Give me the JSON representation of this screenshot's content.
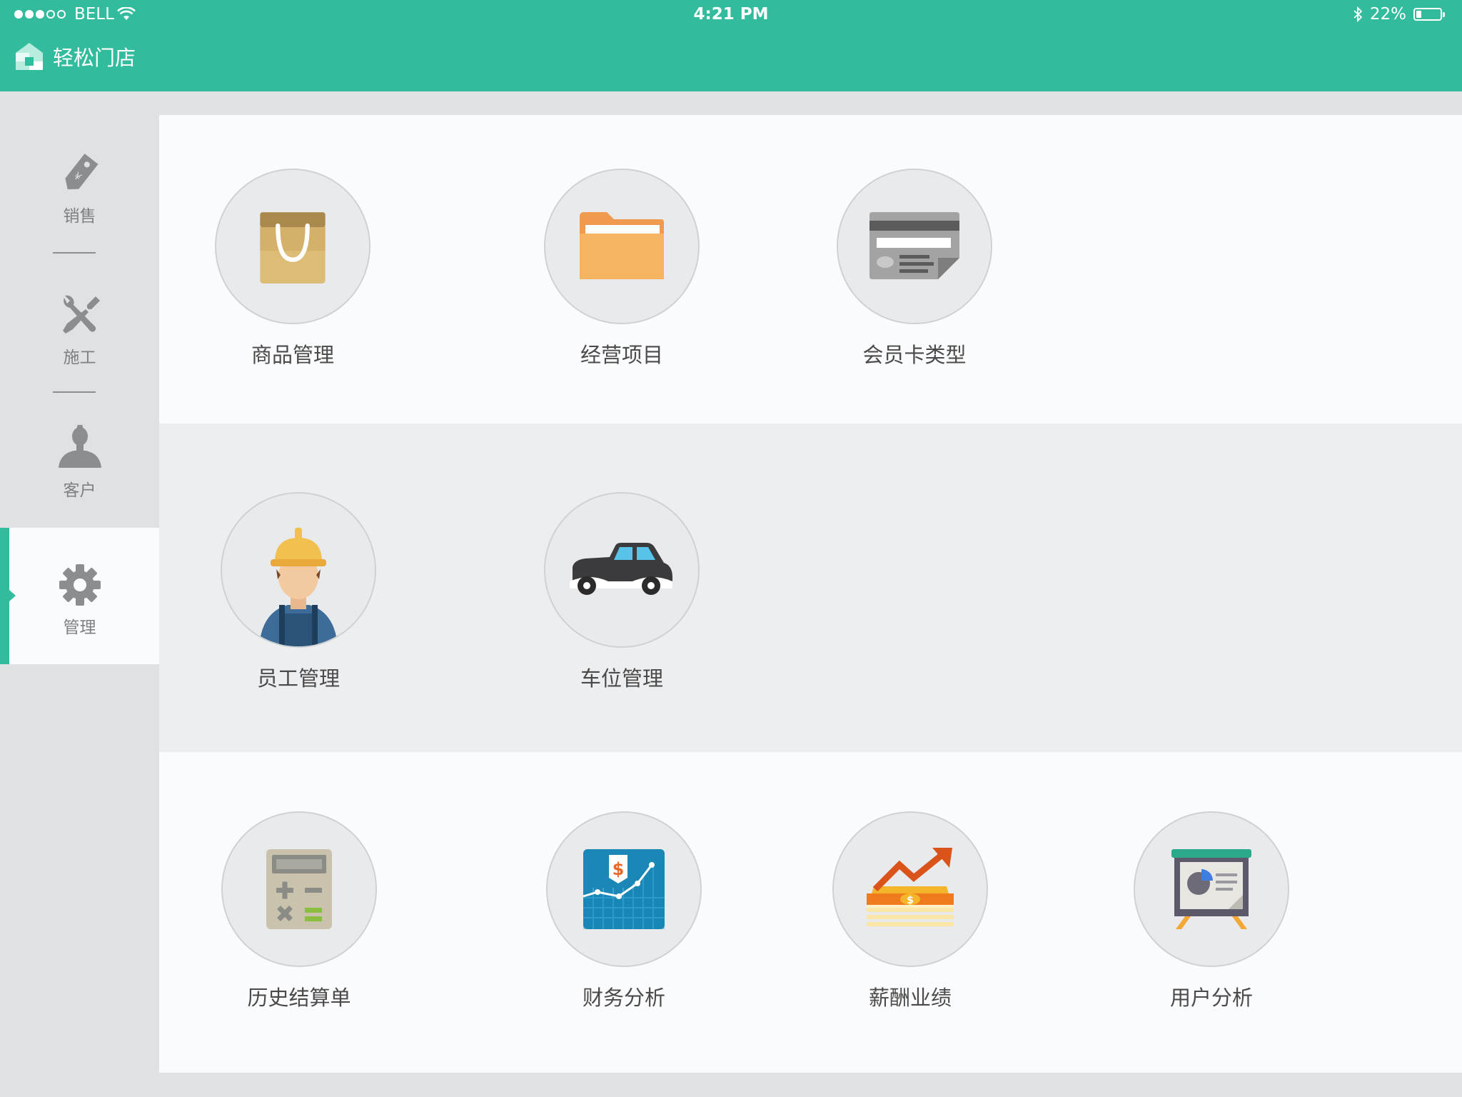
{
  "status_bar": {
    "signal_filled": 3,
    "signal_total": 5,
    "carrier": "BELL",
    "time": "4:21 PM",
    "battery": "22%",
    "battery_level": 0.22,
    "icons": [
      "wifi-icon",
      "bluetooth-icon",
      "battery-icon"
    ]
  },
  "header": {
    "title": "轻松门店",
    "logo_icon": "store-logo-icon"
  },
  "sidebar": {
    "items": [
      {
        "label": "销售",
        "icon": "price-tag-icon",
        "active": false
      },
      {
        "label": "施工",
        "icon": "tools-icon",
        "active": false
      },
      {
        "label": "客户",
        "icon": "person-icon",
        "active": false
      },
      {
        "label": "管理",
        "icon": "gear-icon",
        "active": true
      }
    ]
  },
  "sections": [
    {
      "items": [
        {
          "label": "商品管理",
          "icon": "shopping-bag-icon"
        },
        {
          "label": "经营项目",
          "icon": "folder-icon"
        },
        {
          "label": "会员卡类型",
          "icon": "member-card-icon"
        }
      ]
    },
    {
      "items": [
        {
          "label": "员工管理",
          "icon": "worker-icon"
        },
        {
          "label": "车位管理",
          "icon": "car-icon"
        }
      ]
    },
    {
      "items": [
        {
          "label": "历史结算单",
          "icon": "calculator-icon"
        },
        {
          "label": "财务分析",
          "icon": "finance-chart-icon"
        },
        {
          "label": "薪酬业绩",
          "icon": "money-growth-icon"
        },
        {
          "label": "用户分析",
          "icon": "presentation-board-icon"
        }
      ]
    }
  ],
  "colors": {
    "brand": "#32bb9c",
    "sidebar_bg": "#dfe1e2",
    "panel_light": "#fafbfc",
    "panel_gray": "#eceef0",
    "icon_gray": "#7d8184"
  }
}
